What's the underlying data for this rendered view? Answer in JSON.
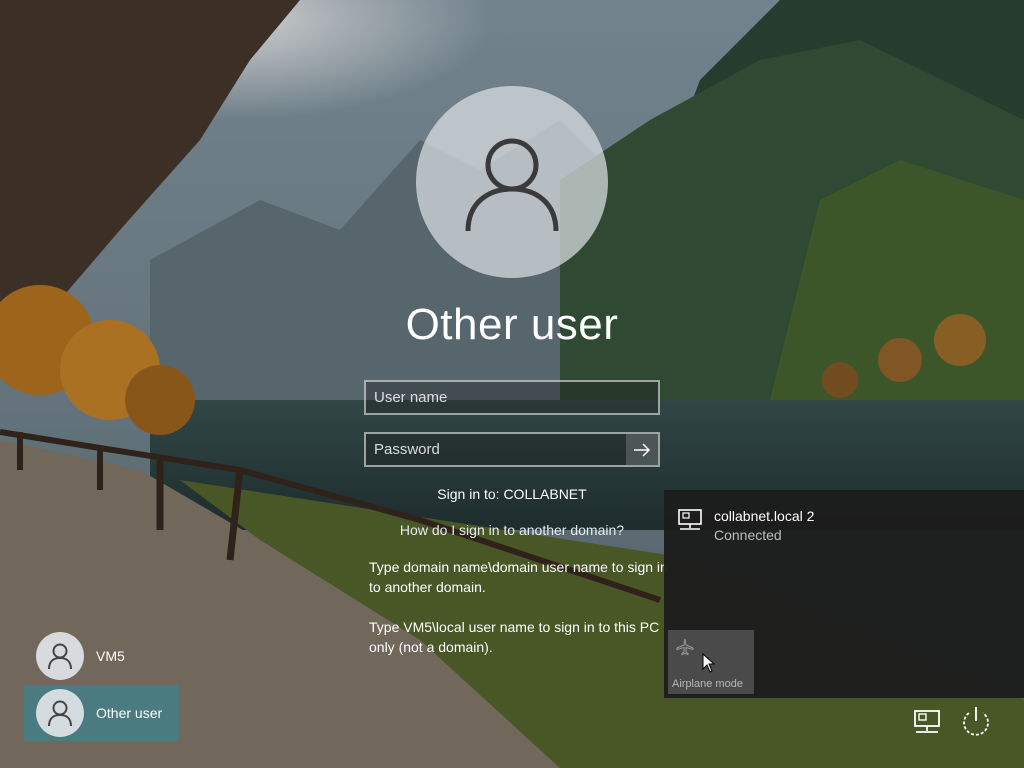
{
  "login": {
    "title": "Other user",
    "username_placeholder": "User name",
    "password_placeholder": "Password",
    "sign_in_to": "Sign in to: COLLABNET",
    "how_link": "How do I sign in to another domain?",
    "help_domain": "Type domain name\\domain user name to sign in to another domain.",
    "help_local": "Type VM5\\local user name to sign in to this PC only (not a domain)."
  },
  "users": [
    {
      "name": "VM5",
      "selected": false
    },
    {
      "name": "Other user",
      "selected": true
    }
  ],
  "network_flyout": {
    "network_name": "collabnet.local 2",
    "status": "Connected",
    "airplane_tile_label": "Airplane mode"
  },
  "icons": {
    "avatar": "person-icon",
    "submit": "arrow-right-icon",
    "network": "ethernet-network-icon",
    "airplane": "airplane-icon",
    "power": "power-icon",
    "cursor": "mouse-pointer-icon"
  }
}
